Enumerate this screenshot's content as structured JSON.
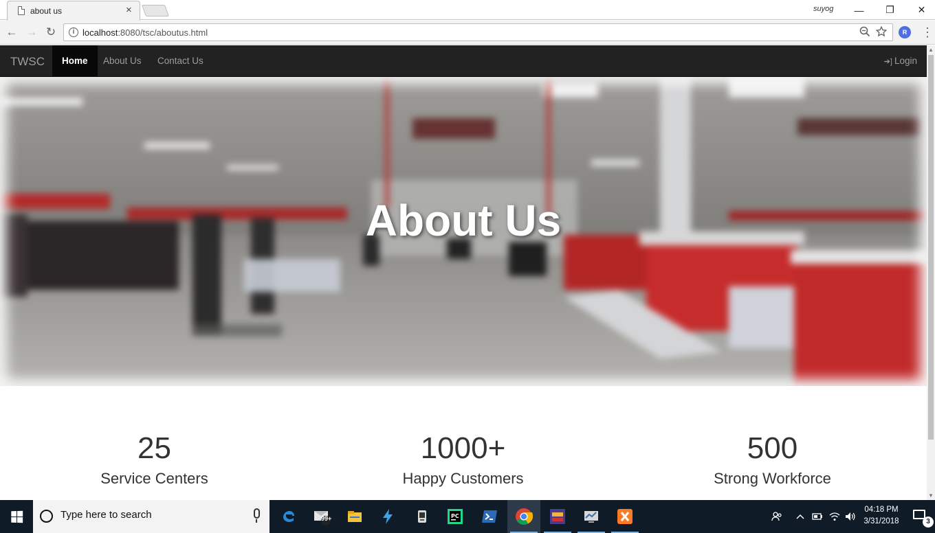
{
  "browser": {
    "tab_title": "about us",
    "tab_close": "×",
    "profile_name": "suyog",
    "window_controls": {
      "minimize": "—",
      "restore": "❐",
      "close": "✕"
    },
    "nav": {
      "back": "←",
      "forward": "→",
      "reload": "↻"
    },
    "url_host": "localhost",
    "url_rest": ":8080/tsc/aboutus.html",
    "info_glyph": "i",
    "extension_letter": "R",
    "menu_glyph": "⋮",
    "icons": [
      "page-icon",
      "back-arrow-icon",
      "forward-arrow-icon",
      "reload-icon",
      "info-icon",
      "zoom-icon",
      "star-icon",
      "extension-icon",
      "menu-icon"
    ]
  },
  "site": {
    "brand": "TWSC",
    "nav": [
      {
        "label": "Home",
        "active": true
      },
      {
        "label": "About Us",
        "active": false
      },
      {
        "label": "Contact Us",
        "active": false
      }
    ],
    "login_icon": "➔]",
    "login_label": "Login",
    "hero_title": "About Us",
    "stats": [
      {
        "value": "25",
        "label": "Service Centers"
      },
      {
        "value": "1000+",
        "label": "Happy Customers"
      },
      {
        "value": "500",
        "label": "Strong Workforce"
      }
    ]
  },
  "taskbar": {
    "search_placeholder": "Type here to search",
    "apps": [
      "edge-icon",
      "mail-icon",
      "file-explorer-icon",
      "vscode-icon",
      "tool-icon",
      "pycharm-icon",
      "powershell-icon",
      "chrome-icon",
      "game-icon",
      "network-icon",
      "xampp-icon"
    ],
    "mail_badge": "99+",
    "clock_time": "04:18 PM",
    "clock_date": "3/31/2018",
    "notification_count": "3"
  },
  "colors": {
    "navbar_bg": "#222222",
    "navbar_active_bg": "#080808",
    "navbar_text": "#9d9d9d",
    "taskbar_bg": "#101b28",
    "stat_text": "#333333"
  }
}
